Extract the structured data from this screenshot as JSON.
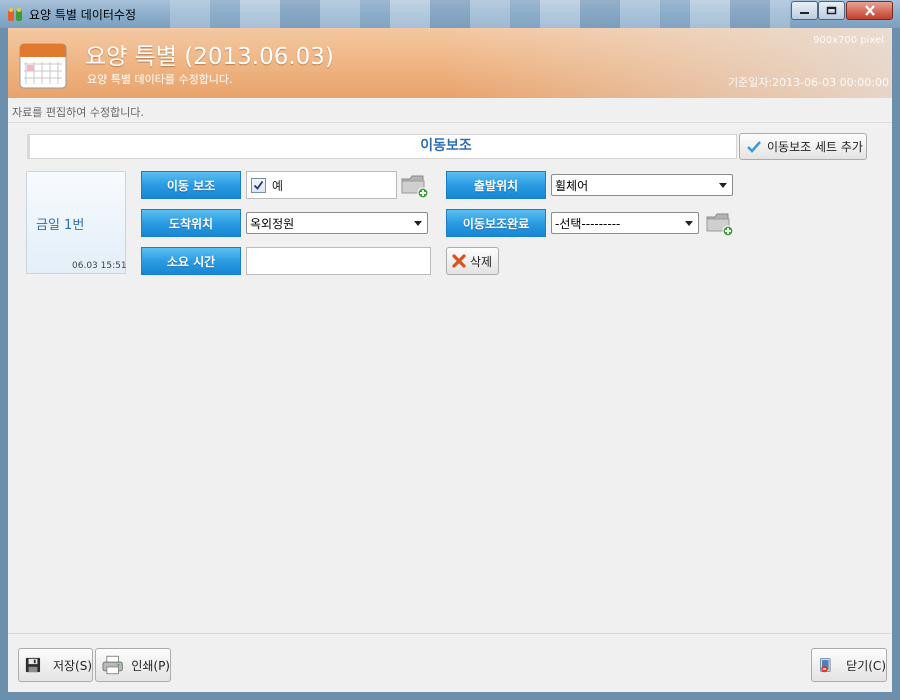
{
  "window": {
    "title": "요양 특별 데이터수정"
  },
  "header": {
    "title": "요양 특별 (2013.06.03)",
    "subtitle": "요양 특별 데이타를 수정합니다.",
    "size_note": "900x700 pixel",
    "base_date": "기준일자:2013-06-03 00:00:00"
  },
  "hint": "자료를 편집하여 수정합니다.",
  "section": {
    "title": "이동보조",
    "add_set_button": "이동보조 세트 추가"
  },
  "card": {
    "title": "금일 1번",
    "time": "06.03 15:51"
  },
  "form": {
    "move_assist": {
      "label": "이동 보조",
      "checked": true,
      "value": "예"
    },
    "departure": {
      "label": "출발위치",
      "value": "휠체어"
    },
    "arrival": {
      "label": "도착위치",
      "value": "옥외정원"
    },
    "complete": {
      "label": "이동보조완료",
      "value": "-선택---------"
    },
    "duration": {
      "label": "소요 시간",
      "value": ""
    },
    "delete_button": "삭제"
  },
  "footer": {
    "save": "저장(S)",
    "print": "인쇄(P)",
    "close": "닫기(C)"
  },
  "colors": {
    "accent": "#2f6fb0",
    "label_blue": "#2c9be2",
    "header_orange": "#eeb27f"
  }
}
